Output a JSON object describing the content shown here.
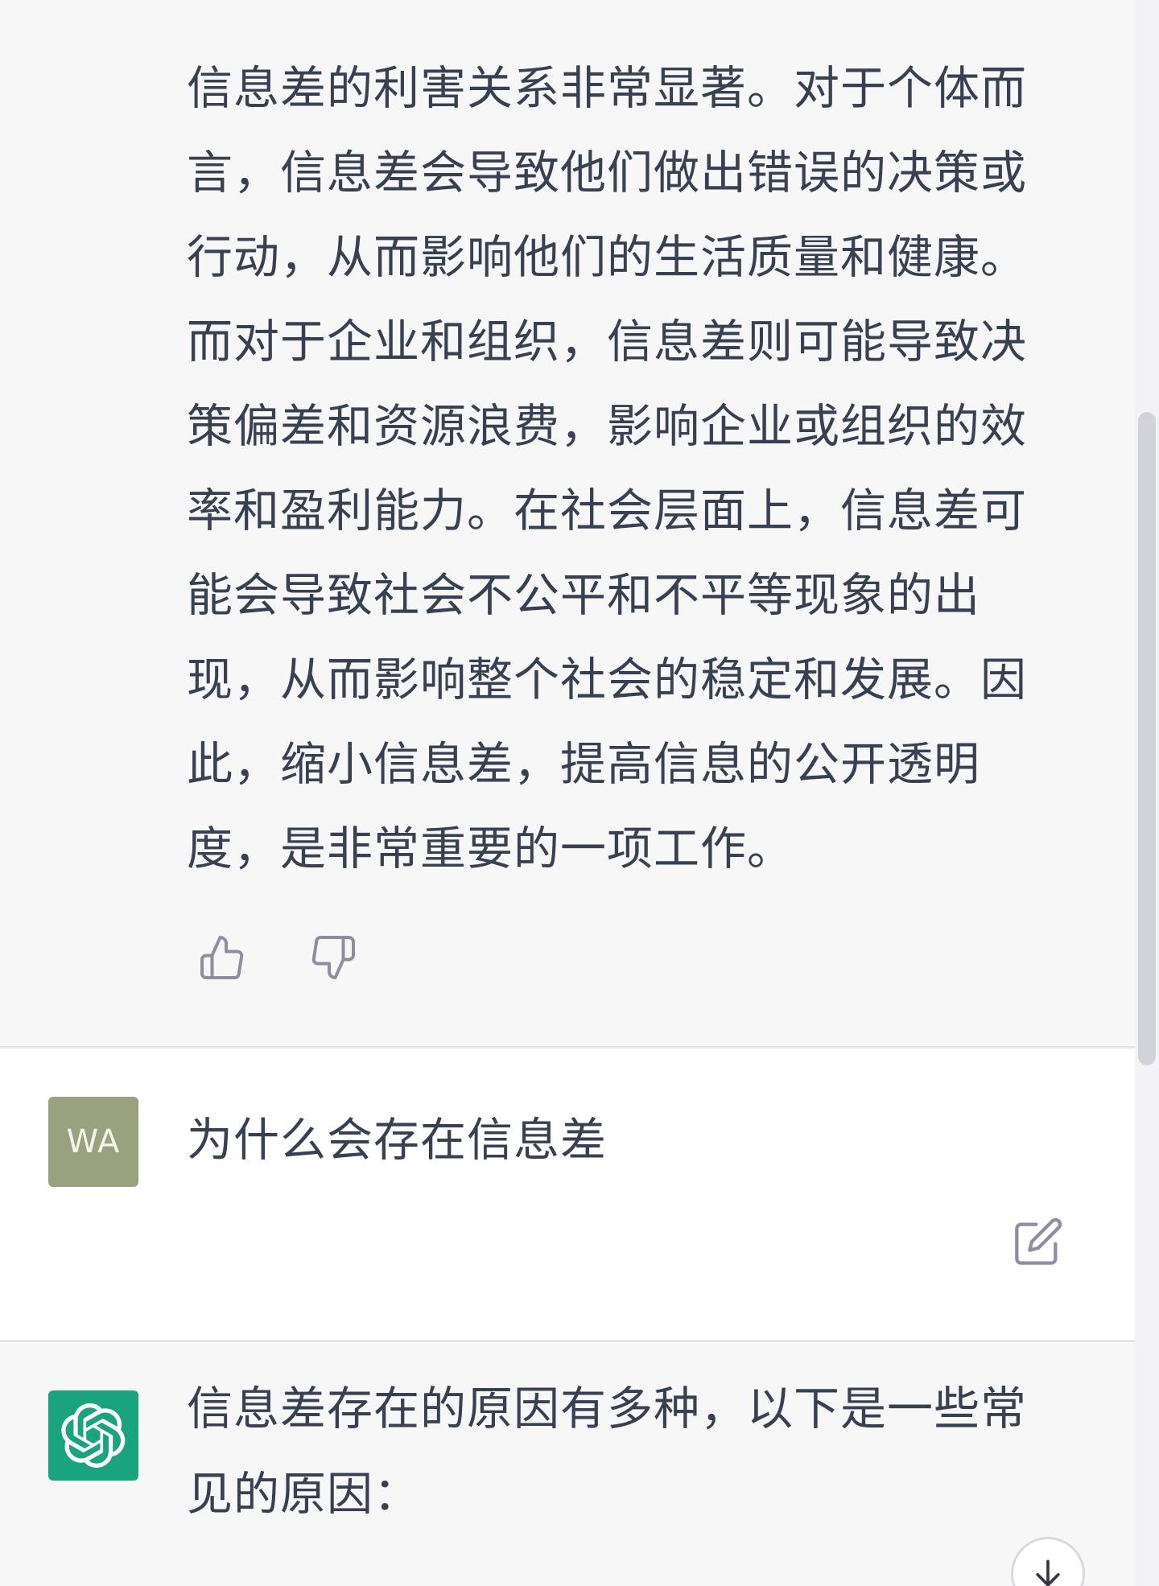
{
  "conversation": {
    "assistant_previous": {
      "text": "信息差的利害关系非常显著。对于个体而\n言，信息差会导致他们做出错误的决策或\n行动，从而影响他们的生活质量和健康。\n而对于企业和组织，信息差则可能导致决\n策偏差和资源浪费，影响企业或组织的效\n率和盈利能力。在社会层面上，信息差可\n能会导致社会不公平和不平等现象的出\n现，从而影响整个社会的稳定和发展。因\n此，缩小信息差，提高信息的公开透明\n度，是非常重要的一项工作。",
      "thumbs_up_icon": "thumbs-up-icon",
      "thumbs_down_icon": "thumbs-down-icon"
    },
    "user_message": {
      "avatar_initials": "WA",
      "text": "为什么会存在信息差",
      "edit_icon": "edit-icon"
    },
    "assistant_current": {
      "text": "信息差存在的原因有多种，以下是一些常\n见的原因："
    }
  },
  "controls": {
    "scroll_down_icon": "arrow-down-icon"
  },
  "colors": {
    "assistant_bg": "#f7f7f8",
    "user_bg": "#ffffff",
    "user_avatar": "#9aa17f",
    "gpt_avatar": "#19a37f",
    "text": "#374151"
  }
}
